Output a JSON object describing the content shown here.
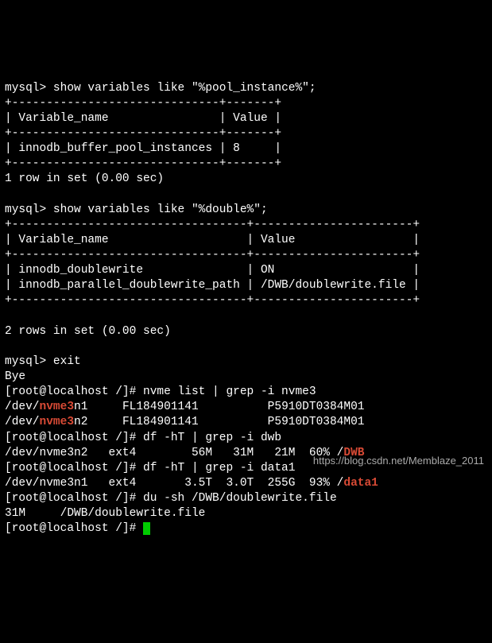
{
  "mysql1": {
    "prompt": "mysql> ",
    "cmd": "show variables like \"%pool_instance%\";",
    "sep1": "+------------------------------+-------+",
    "head": "| Variable_name                | Value |",
    "sep2": "+------------------------------+-------+",
    "row": "| innodb_buffer_pool_instances | 8     |",
    "sep3": "+------------------------------+-------+",
    "summary": "1 row in set (0.00 sec)"
  },
  "mysql2": {
    "prompt": "mysql> ",
    "cmd": "show variables like \"%double%\";",
    "sep1": "+----------------------------------+-----------------------+",
    "head": "| Variable_name                    | Value                 |",
    "sep2": "+----------------------------------+-----------------------+",
    "row1": "| innodb_doublewrite               | ON                    |",
    "row2": "| innodb_parallel_doublewrite_path | /DWB/doublewrite.file |",
    "sep3": "+----------------------------------+-----------------------+",
    "summary": "2 rows in set (0.00 sec)"
  },
  "exit": {
    "prompt": "mysql> ",
    "cmd": "exit",
    "bye": "Bye"
  },
  "shell_prompt": "[root@localhost /]# ",
  "nvme_cmd": "nvme list | grep -i nvme3",
  "nvme_line1": {
    "pre": "/dev/",
    "hl": "nvme3",
    "post": "n1     FL184901141          P5910DT0384M01"
  },
  "nvme_line2": {
    "pre": "/dev/",
    "hl": "nvme3",
    "post": "n2     FL184901141          P5910DT0384M01"
  },
  "df1_cmd": "df -hT | grep -i dwb",
  "df1_line": {
    "pre": "/dev/nvme3n2   ext4        56M   31M   21M  60% /",
    "hl": "DWB"
  },
  "df2_cmd": "df -hT | grep -i data1",
  "df2_line": {
    "pre": "/dev/nvme3n1   ext4       3.5T  3.0T  255G  93% /",
    "hl": "data1"
  },
  "du_cmd": "du -sh /DWB/doublewrite.file",
  "du_out": "31M     /DWB/doublewrite.file",
  "watermark": "https://blog.csdn.net/Memblaze_2011",
  "blank": ""
}
